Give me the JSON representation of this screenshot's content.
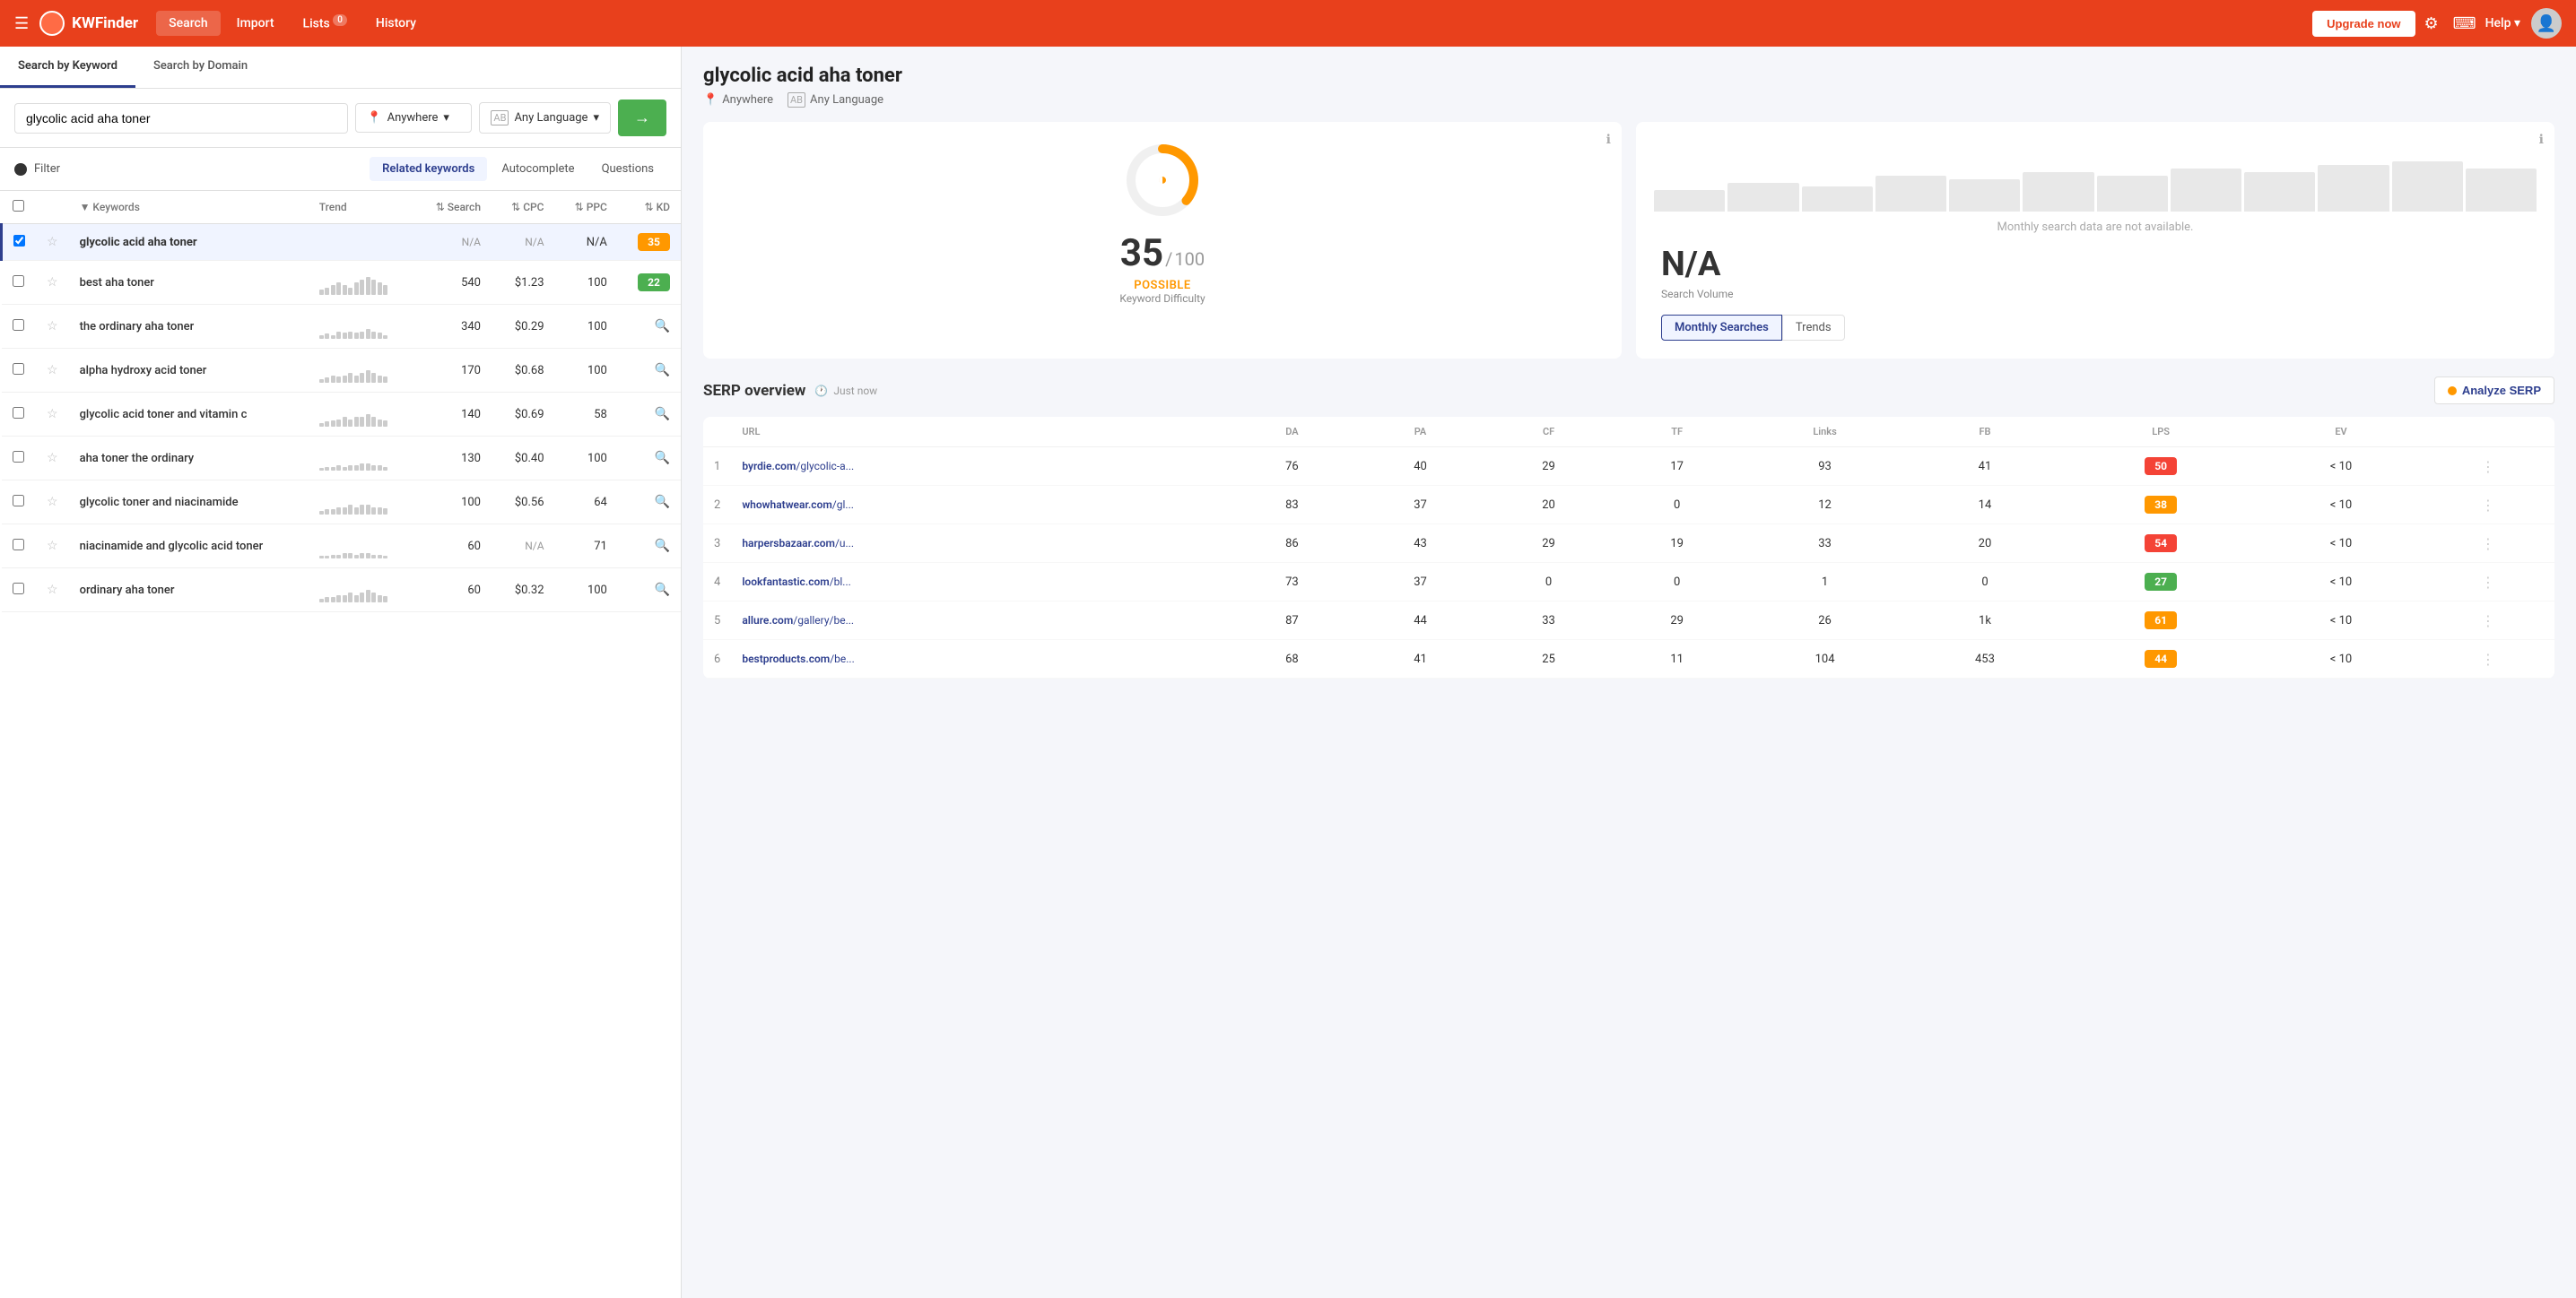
{
  "app": {
    "brand": "KWFinder",
    "nav_items": [
      "Search",
      "Import",
      "Lists",
      "History"
    ],
    "lists_badge": "0",
    "upgrade_label": "Upgrade now",
    "help_label": "Help"
  },
  "search": {
    "tab_keyword": "Search by Keyword",
    "tab_domain": "Search by Domain",
    "query": "glycolic acid aha toner",
    "location": "Anywhere",
    "language": "Any Language",
    "search_btn_arrow": "→",
    "filter_label": "Filter",
    "filter_tabs": [
      "Related keywords",
      "Autocomplete",
      "Questions"
    ]
  },
  "table": {
    "columns": [
      "Keywords",
      "Trend",
      "Search",
      "CPC",
      "PPC",
      "KD"
    ],
    "rows": [
      {
        "keyword": "glycolic acid aha toner",
        "trend": [],
        "search": "N/A",
        "cpc": "N/A",
        "ppc": "N/A",
        "kd": 35,
        "kd_class": "kd-orange",
        "selected": true,
        "search_na": true
      },
      {
        "keyword": "best aha toner",
        "trend": [
          3,
          4,
          5,
          6,
          5,
          4,
          6,
          7,
          8,
          7,
          6,
          5
        ],
        "search": "540",
        "cpc": "$1.23",
        "ppc": "100",
        "kd": 22,
        "kd_class": "kd-green"
      },
      {
        "keyword": "the ordinary aha toner",
        "trend": [
          2,
          3,
          2,
          4,
          3,
          4,
          3,
          4,
          5,
          4,
          3,
          2
        ],
        "search": "340",
        "cpc": "$0.29",
        "ppc": "100",
        "kd": null
      },
      {
        "keyword": "alpha hydroxy acid toner",
        "trend": [
          2,
          3,
          4,
          3,
          4,
          5,
          4,
          5,
          6,
          5,
          4,
          3
        ],
        "search": "170",
        "cpc": "$0.68",
        "ppc": "100",
        "kd": null
      },
      {
        "keyword": "glycolic acid toner and vitamin c",
        "trend": [
          2,
          3,
          3,
          4,
          5,
          4,
          5,
          5,
          6,
          5,
          4,
          3
        ],
        "search": "140",
        "cpc": "$0.69",
        "ppc": "58",
        "kd": null
      },
      {
        "keyword": "aha toner the ordinary",
        "trend": [
          1,
          2,
          2,
          3,
          2,
          3,
          3,
          4,
          4,
          3,
          3,
          2
        ],
        "search": "130",
        "cpc": "$0.40",
        "ppc": "100",
        "kd": null
      },
      {
        "keyword": "glycolic toner and niacinamide",
        "trend": [
          2,
          3,
          3,
          4,
          4,
          5,
          4,
          5,
          5,
          4,
          4,
          3
        ],
        "search": "100",
        "cpc": "$0.56",
        "ppc": "64",
        "kd": null
      },
      {
        "keyword": "niacinamide and glycolic acid toner",
        "trend": [
          1,
          1,
          2,
          2,
          3,
          3,
          2,
          3,
          3,
          2,
          2,
          1
        ],
        "search": "60",
        "cpc": "N/A",
        "ppc": "71",
        "kd": null
      },
      {
        "keyword": "ordinary aha toner",
        "trend": [
          2,
          3,
          3,
          4,
          4,
          5,
          4,
          5,
          6,
          5,
          4,
          3
        ],
        "search": "60",
        "cpc": "$0.32",
        "ppc": "100",
        "kd": null
      }
    ]
  },
  "right": {
    "keyword_title": "glycolic acid aha toner",
    "location": "Anywhere",
    "language": "Any Language",
    "kd_value": 35,
    "kd_max": 100,
    "kd_status": "POSSIBLE",
    "kd_label": "Keyword Difficulty",
    "sv_value": "N/A",
    "sv_label": "Search Volume",
    "monthly_unavail": "Monthly search data are not available.",
    "sv_tab_monthly": "Monthly Searches",
    "sv_tab_trends": "Trends",
    "serp_title": "SERP overview",
    "serp_time": "Just now",
    "analyze_label": "Analyze SERP",
    "serp_cols": [
      "",
      "URL",
      "DA",
      "PA",
      "CF",
      "TF",
      "Links",
      "FB",
      "LPS",
      "EV",
      ""
    ],
    "serp_rows": [
      {
        "rank": 1,
        "url_base": "byrdie.com",
        "url_path": "/glycolic-a...",
        "da": 76,
        "pa": 40,
        "cf": 29,
        "tf": 17,
        "links": 93,
        "fb": 41,
        "lps": 50,
        "lps_class": "lps-50",
        "ev": "< 10"
      },
      {
        "rank": 2,
        "url_base": "whowhatwear.com",
        "url_path": "/gl...",
        "da": 83,
        "pa": 37,
        "cf": 20,
        "tf": 0,
        "links": 12,
        "fb": 14,
        "lps": 38,
        "lps_class": "lps-38",
        "ev": "< 10"
      },
      {
        "rank": 3,
        "url_base": "harpersbazaar.com",
        "url_path": "/u...",
        "da": 86,
        "pa": 43,
        "cf": 29,
        "tf": 19,
        "links": 33,
        "fb": 20,
        "lps": 54,
        "lps_class": "lps-54",
        "ev": "< 10"
      },
      {
        "rank": 4,
        "url_base": "lookfantastic.com",
        "url_path": "/bl...",
        "da": 73,
        "pa": 37,
        "cf": 0,
        "tf": 0,
        "links": 1,
        "fb": 0,
        "lps": 27,
        "lps_class": "lps-27",
        "ev": "< 10"
      },
      {
        "rank": 5,
        "url_base": "allure.com",
        "url_path": "/gallery/be...",
        "da": 87,
        "pa": 44,
        "cf": 33,
        "tf": 29,
        "links": 26,
        "fb": "1k",
        "lps": 61,
        "lps_class": "lps-61",
        "ev": "< 10"
      },
      {
        "rank": 6,
        "url_base": "bestproducts.com",
        "url_path": "/be...",
        "da": 68,
        "pa": 41,
        "cf": 25,
        "tf": 11,
        "links": 104,
        "fb": 453,
        "lps": 44,
        "lps_class": "lps-44",
        "ev": "< 10"
      }
    ]
  }
}
